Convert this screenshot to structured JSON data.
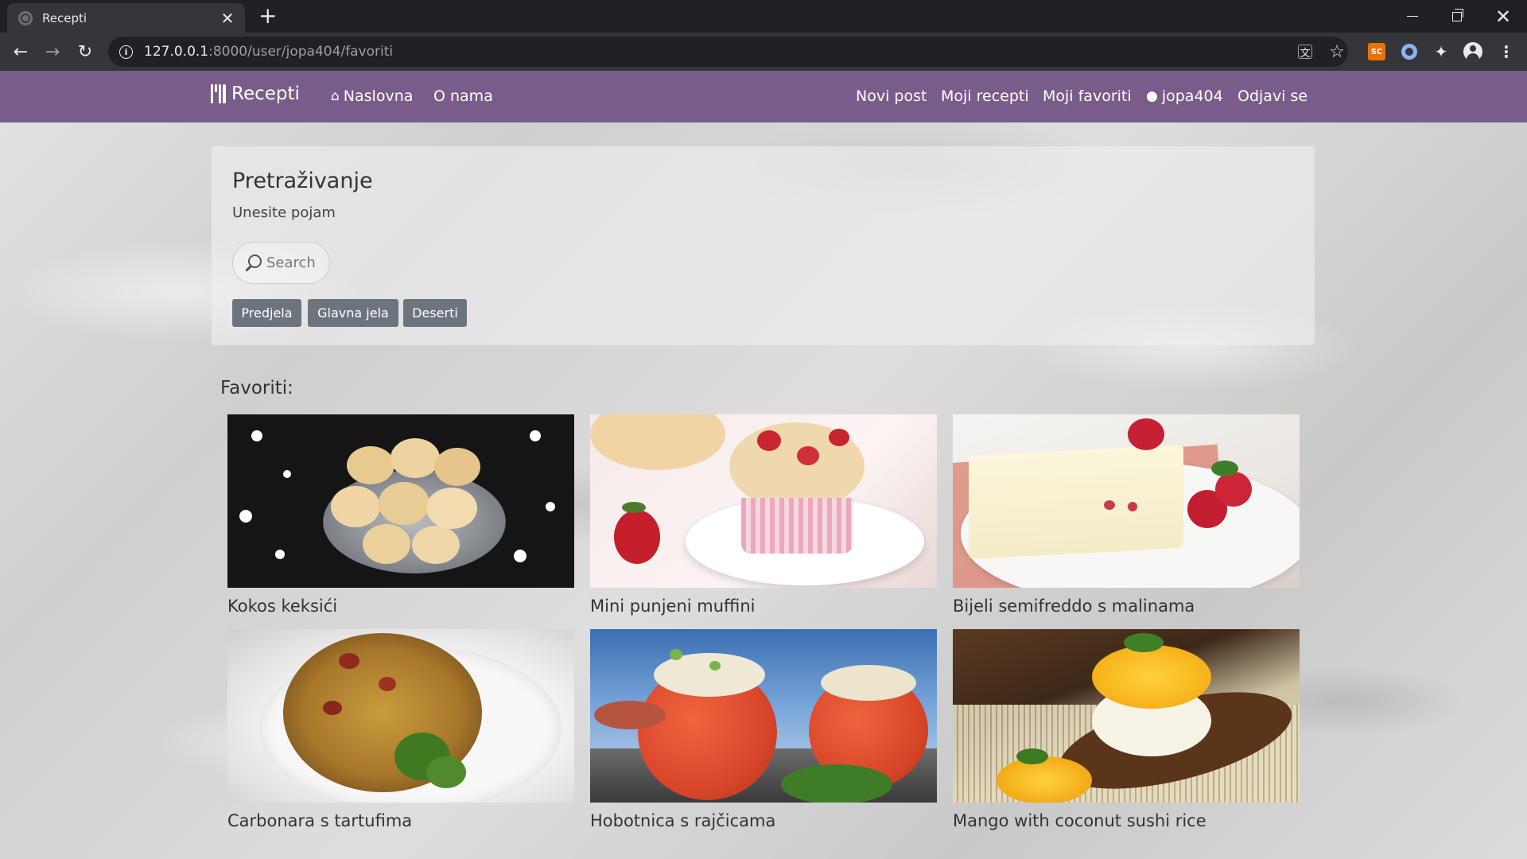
{
  "browser": {
    "tab_title": "Recepti",
    "tab_close": "✕",
    "new_tab": "+",
    "url_host": "127.0.0.1",
    "url_rest": ":8000/user/jopa404/favoriti",
    "ext_sc_label": "SC"
  },
  "site": {
    "brand": "Recepti",
    "nav_left": [
      {
        "label": "Naslovna",
        "icon": "home-icon"
      },
      {
        "label": "O nama"
      }
    ],
    "nav_right": [
      {
        "label": "Novi post"
      },
      {
        "label": "Moji recepti"
      },
      {
        "label": "Moji favoriti"
      },
      {
        "label": "jopa404",
        "icon": "user-icon"
      },
      {
        "label": "Odjavi se"
      }
    ]
  },
  "search": {
    "title": "Pretraživanje",
    "subtitle": "Unesite pojam",
    "placeholder": "Search",
    "categories": [
      "Predjela",
      "Glavna jela",
      "Deserti"
    ]
  },
  "favorites": {
    "heading": "Favoriti:",
    "items": [
      {
        "title": "Kokos keksići"
      },
      {
        "title": "Mini punjeni muffini"
      },
      {
        "title": "Bijeli semifreddo s malinama"
      },
      {
        "title": "Carbonara s tartufima"
      },
      {
        "title": "Hobotnica s rajčicama"
      },
      {
        "title": "Mango with coconut sushi rice"
      }
    ]
  },
  "colors": {
    "navbar": "#7a5c8a",
    "category_button": "#6c757d",
    "chrome_dark": "#202124",
    "chrome_toolbar": "#35363a"
  }
}
